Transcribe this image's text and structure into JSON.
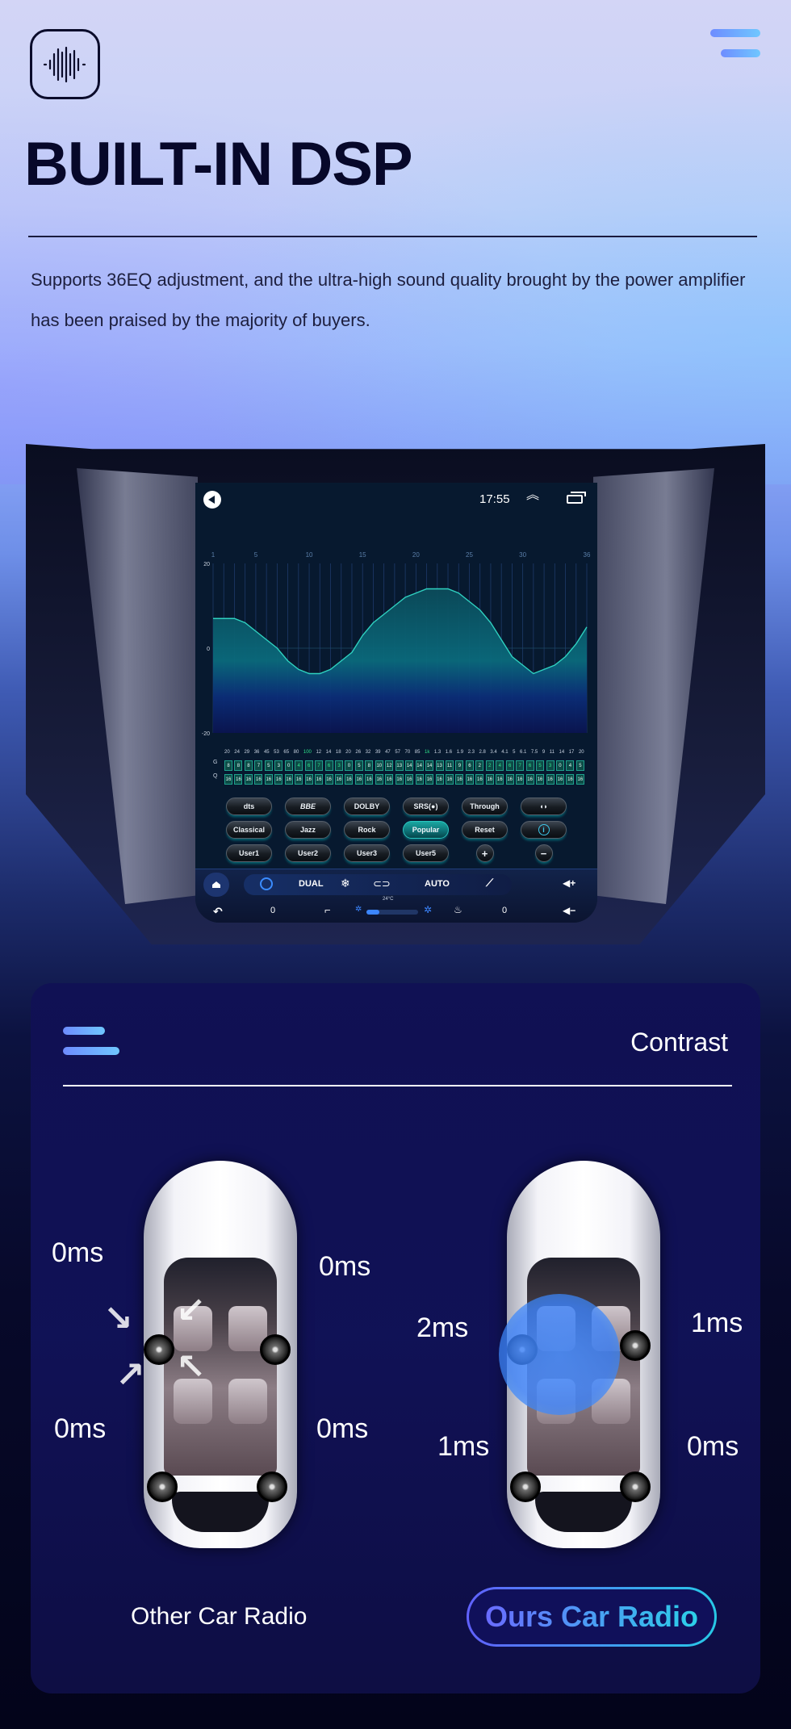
{
  "header": {
    "logo_icon": "sound-wave-icon",
    "menu_icon": "menu-icon",
    "title": "BUILT-IN DSP",
    "description": "Supports 36EQ adjustment, and the ultra-high sound quality brought by the power amplifier has been praised by the majority of buyers."
  },
  "head_unit": {
    "status_bar": {
      "back_icon": "back-icon",
      "time": "17:55",
      "up_icon": "double-chevron-up-icon",
      "recent_apps_icon": "recent-apps-icon"
    },
    "eq": {
      "band_ticks": [
        "1",
        "5",
        "10",
        "15",
        "20",
        "25",
        "30",
        "36"
      ],
      "y_ticks": [
        "20",
        "0",
        "-20"
      ],
      "g_label": "G",
      "q_label": "Q",
      "frequencies": [
        "20",
        "24",
        "29",
        "36",
        "45",
        "53",
        "65",
        "80",
        "100",
        "12",
        "14",
        "18",
        "20",
        "26",
        "32",
        "39",
        "47",
        "57",
        "70",
        "85",
        "1k",
        "1.3",
        "1.6",
        "1.9",
        "2.3",
        "2.8",
        "3.4",
        "4.1",
        "5",
        "6.1",
        "7.5",
        "9",
        "11",
        "14",
        "17",
        "20"
      ],
      "highlight_frequencies": [
        8,
        20
      ],
      "gains": [
        "8",
        "8",
        "8",
        "7",
        "5",
        "3",
        "0",
        "4",
        "6",
        "7",
        "6",
        "3",
        "0",
        "5",
        "8",
        "10",
        "12",
        "13",
        "14",
        "14",
        "14",
        "13",
        "11",
        "9",
        "6",
        "2",
        "2",
        "4",
        "6",
        "7",
        "6",
        "5",
        "3",
        "0",
        "4",
        "5"
      ],
      "highlight_gains": [
        7,
        8,
        9,
        10,
        11,
        26,
        27,
        28,
        29,
        30,
        31,
        32
      ],
      "q_values": [
        "16",
        "16",
        "16",
        "16",
        "16",
        "16",
        "16",
        "16",
        "16",
        "16",
        "16",
        "16",
        "16",
        "16",
        "16",
        "16",
        "16",
        "16",
        "16",
        "16",
        "16",
        "16",
        "16",
        "16",
        "16",
        "16",
        "16",
        "16",
        "16",
        "16",
        "16",
        "16",
        "16",
        "16",
        "16",
        "16"
      ]
    },
    "sound_effects": [
      {
        "label": "dts",
        "active": false
      },
      {
        "label": "BBE",
        "active": false
      },
      {
        "label": "DOLBY",
        "active": false
      },
      {
        "label": "SRS(●)",
        "active": false
      },
      {
        "label": "Through",
        "active": false
      },
      {
        "label": "◖◗",
        "active": false
      }
    ],
    "presets": [
      {
        "label": "Classical",
        "active": false
      },
      {
        "label": "Jazz",
        "active": false
      },
      {
        "label": "Rock",
        "active": false
      },
      {
        "label": "Popular",
        "active": true
      },
      {
        "label": "Reset",
        "active": false
      },
      {
        "label": "i",
        "active": false
      }
    ],
    "user_presets": [
      {
        "label": "User1"
      },
      {
        "label": "User2"
      },
      {
        "label": "User3"
      },
      {
        "label": "User5"
      },
      {
        "label": "+"
      },
      {
        "label": "−"
      }
    ],
    "climate": {
      "dual_label": "DUAL",
      "auto_label": "AUTO",
      "snow_icon": "❄",
      "temperature": "24°C",
      "left_seat_value": "0",
      "right_seat_value": "0",
      "fan_level": 0.25,
      "vol_up": "◀+",
      "vol_down": "◀−",
      "back_icon": "↶"
    }
  },
  "contrast": {
    "title": "Contrast",
    "other": {
      "label": "Other Car Radio",
      "delays": {
        "front_left": "0ms",
        "front_right": "0ms",
        "rear_left": "0ms",
        "rear_right": "0ms"
      }
    },
    "ours": {
      "label": "Ours Car Radio",
      "delays": {
        "front_left": "2ms",
        "front_right": "1ms",
        "rear_left": "1ms",
        "rear_right": "0ms"
      }
    }
  },
  "eq_curve": {
    "band_gains_db": [
      7,
      7,
      7,
      6,
      4,
      2,
      0,
      -3,
      -5,
      -6,
      -6,
      -5,
      -3,
      -1,
      3,
      6,
      8,
      10,
      12,
      13,
      14,
      14,
      14,
      13,
      11,
      9,
      6,
      2,
      -2,
      -4,
      -6,
      -5,
      -4,
      -2,
      1,
      5
    ],
    "y_range_db": [
      -20,
      20
    ]
  }
}
